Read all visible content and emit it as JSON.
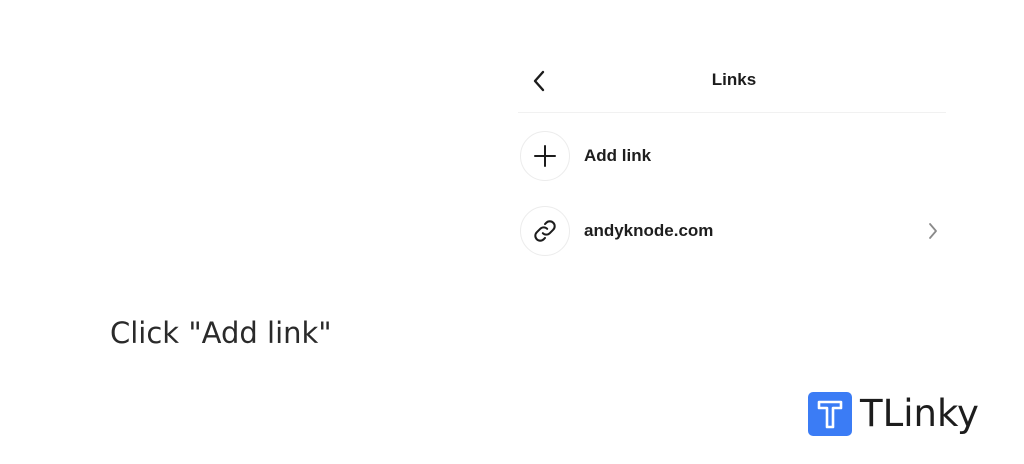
{
  "panel": {
    "title": "Links",
    "back_icon": "chevron-left-icon",
    "rows": [
      {
        "label": "Add link",
        "icon": "plus-icon"
      },
      {
        "label": "andyknode.com",
        "icon": "link-icon",
        "trailing_icon": "chevron-right-icon"
      }
    ]
  },
  "instruction": "Click \"Add link\"",
  "brand": {
    "name": "TLinky",
    "color": "#3b7cf5"
  }
}
